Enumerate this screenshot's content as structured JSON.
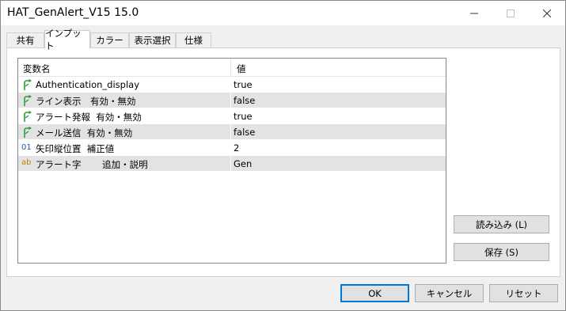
{
  "window": {
    "title": "HAT_GenAlert_V15 15.0"
  },
  "tabs": [
    {
      "label": "共有"
    },
    {
      "label": "インプット"
    },
    {
      "label": "カラー"
    },
    {
      "label": "表示選択"
    },
    {
      "label": "仕様"
    }
  ],
  "active_tab": "インプット",
  "grid": {
    "columns": {
      "name": "変数名",
      "value": "値"
    },
    "rows": [
      {
        "icon": "bool-arrow-icon",
        "name": "Authentication_display",
        "value": "true"
      },
      {
        "icon": "bool-arrow-icon",
        "name": "ライン表示　有効・無効",
        "value": "false"
      },
      {
        "icon": "bool-arrow-icon",
        "name": "アラート発報  有効・無効",
        "value": "true"
      },
      {
        "icon": "bool-arrow-icon",
        "name": "メール送信  有効・無効",
        "value": "false"
      },
      {
        "icon": "int-icon",
        "icon_text": "01",
        "name": "矢印縦位置  補正値",
        "value": "2"
      },
      {
        "icon": "string-icon",
        "icon_text": "ab",
        "name": "アラート字　　 追加・説明",
        "value": "Gen"
      }
    ]
  },
  "buttons": {
    "load": "読み込み (L)",
    "save": "保存 (S)",
    "ok": "OK",
    "cancel": "キャンセル",
    "reset": "リセット"
  },
  "colors": {
    "accent": "#0078d7",
    "bool_icon": "#2e9e3a",
    "int_icon": "#1a57a8",
    "string_icon": "#b8860b"
  }
}
